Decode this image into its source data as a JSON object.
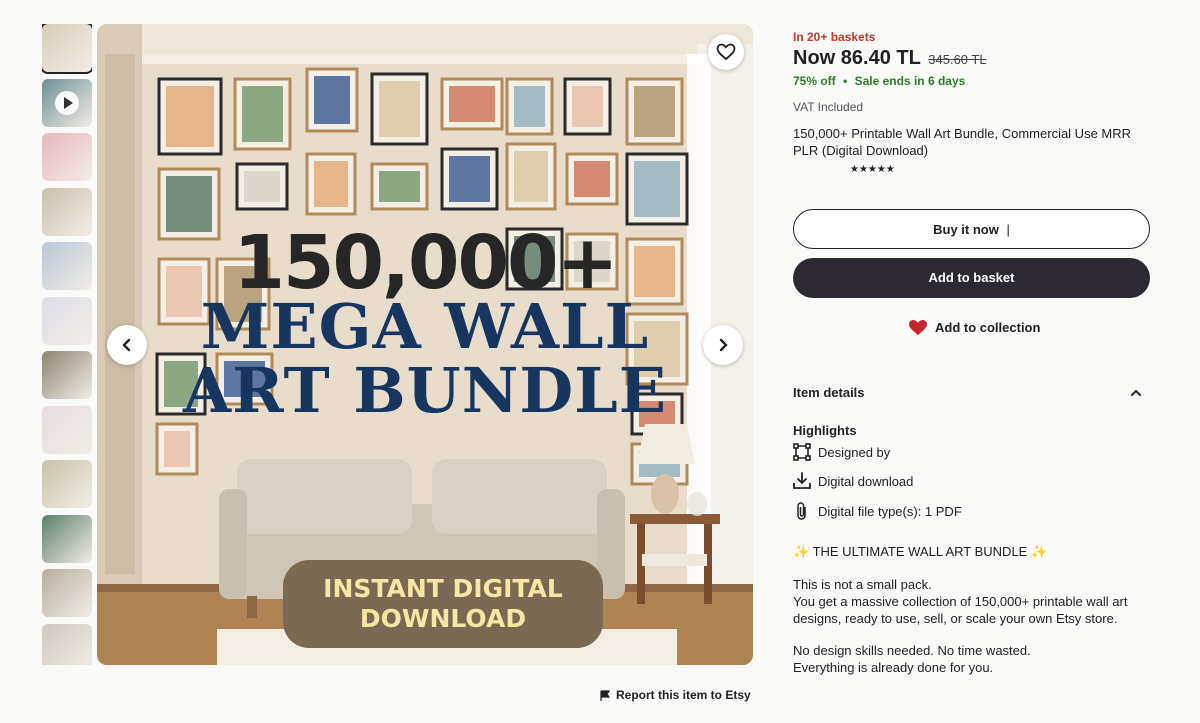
{
  "gallery": {
    "thumb_count": 12,
    "thumb_colors": [
      "#d9cdb9",
      "#6f8f94",
      "#e9b6c0",
      "#cbbfae",
      "#b8c7d6",
      "#dedde8",
      "#8d8470",
      "#e6dde0",
      "#c9c2a9",
      "#5c7f6b",
      "#b7ad9d",
      "#cfc8bd"
    ],
    "hero": {
      "headline_count": "150,000+",
      "headline_line1": "MEGA WALL",
      "headline_line2": "ART BUNDLE",
      "badge_line1": "INSTANT DIGITAL",
      "badge_line2": "DOWNLOAD"
    },
    "report_label": "Report this item to Etsy"
  },
  "listing": {
    "baskets": "In 20+ baskets",
    "price_now": "Now 86.40 TL",
    "price_old": "345.60 TL",
    "discount": "75% off",
    "sale_ends": "Sale ends in 6 days",
    "vat": "VAT Included",
    "title": "150,000+ Printable Wall Art Bundle, Commercial Use MRR PLR (Digital Download)",
    "stars": "★★★★★",
    "buy_now_label": "Buy it now",
    "add_basket_label": "Add to basket",
    "add_collection_label": "Add to collection"
  },
  "details": {
    "heading": "Item details",
    "highlights_heading": "Highlights",
    "designed_by": "Designed by",
    "digital_download": "Digital download",
    "file_types": "Digital file type(s): 1 PDF",
    "bundle_line": "✨ THE ULTIMATE WALL ART BUNDLE ✨",
    "para1_line1": "This is not a small pack.",
    "para1_line2": "You get a massive collection of 150,000+ printable wall art designs, ready to use, sell, or scale your own Etsy store.",
    "para2_line1": "No design skills needed. No time wasted.",
    "para2_line2": "Everything is already done for you."
  },
  "colors": {
    "accent_red": "#c4382b",
    "sale_green": "#2f7a2f",
    "cart_button": "#2d2933",
    "headline_blue": "#17365f"
  }
}
